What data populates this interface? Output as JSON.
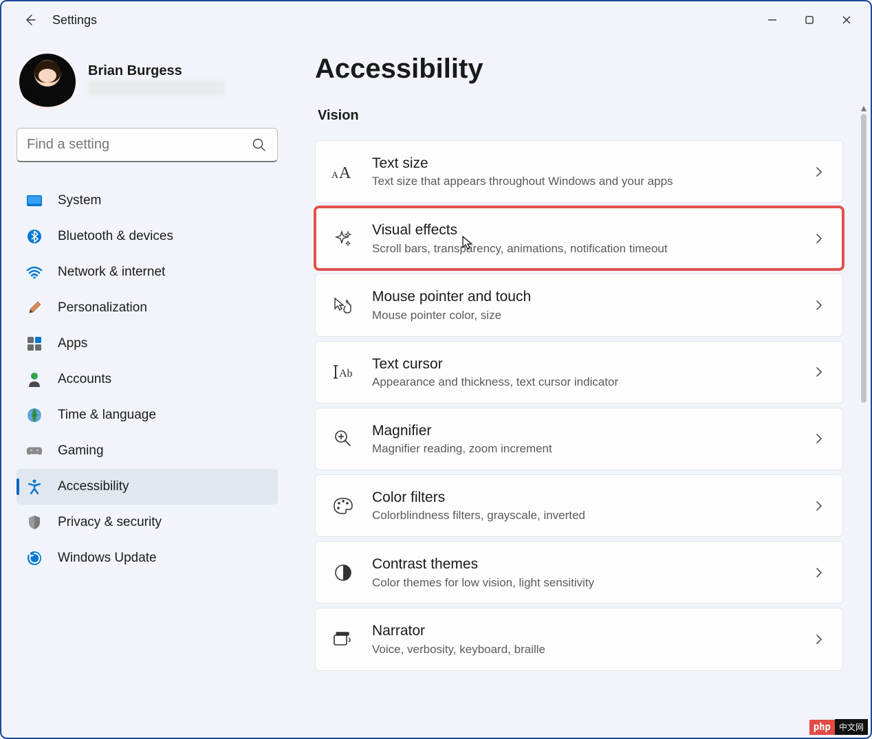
{
  "app": {
    "title": "Settings"
  },
  "user": {
    "name": "Brian Burgess"
  },
  "search": {
    "placeholder": "Find a setting"
  },
  "nav": {
    "items": [
      {
        "label": "System",
        "icon": "system"
      },
      {
        "label": "Bluetooth & devices",
        "icon": "bluetooth"
      },
      {
        "label": "Network & internet",
        "icon": "wifi"
      },
      {
        "label": "Personalization",
        "icon": "brush"
      },
      {
        "label": "Apps",
        "icon": "apps"
      },
      {
        "label": "Accounts",
        "icon": "person"
      },
      {
        "label": "Time & language",
        "icon": "globe"
      },
      {
        "label": "Gaming",
        "icon": "gamepad"
      },
      {
        "label": "Accessibility",
        "icon": "accessibility",
        "active": true
      },
      {
        "label": "Privacy & security",
        "icon": "shield"
      },
      {
        "label": "Windows Update",
        "icon": "update"
      }
    ]
  },
  "page": {
    "title": "Accessibility",
    "section": "Vision",
    "cards": [
      {
        "title": "Text size",
        "sub": "Text size that appears throughout Windows and your apps",
        "icon": "text-size"
      },
      {
        "title": "Visual effects",
        "sub": "Scroll bars, transparency, animations, notification timeout",
        "icon": "sparkle",
        "highlighted": true
      },
      {
        "title": "Mouse pointer and touch",
        "sub": "Mouse pointer color, size",
        "icon": "pointer-touch"
      },
      {
        "title": "Text cursor",
        "sub": "Appearance and thickness, text cursor indicator",
        "icon": "text-cursor"
      },
      {
        "title": "Magnifier",
        "sub": "Magnifier reading, zoom increment",
        "icon": "magnifier"
      },
      {
        "title": "Color filters",
        "sub": "Colorblindness filters, grayscale, inverted",
        "icon": "palette"
      },
      {
        "title": "Contrast themes",
        "sub": "Color themes for low vision, light sensitivity",
        "icon": "contrast"
      },
      {
        "title": "Narrator",
        "sub": "Voice, verbosity, keyboard, braille",
        "icon": "narrator"
      }
    ]
  },
  "watermark": {
    "a": "php",
    "b": "中文网"
  }
}
